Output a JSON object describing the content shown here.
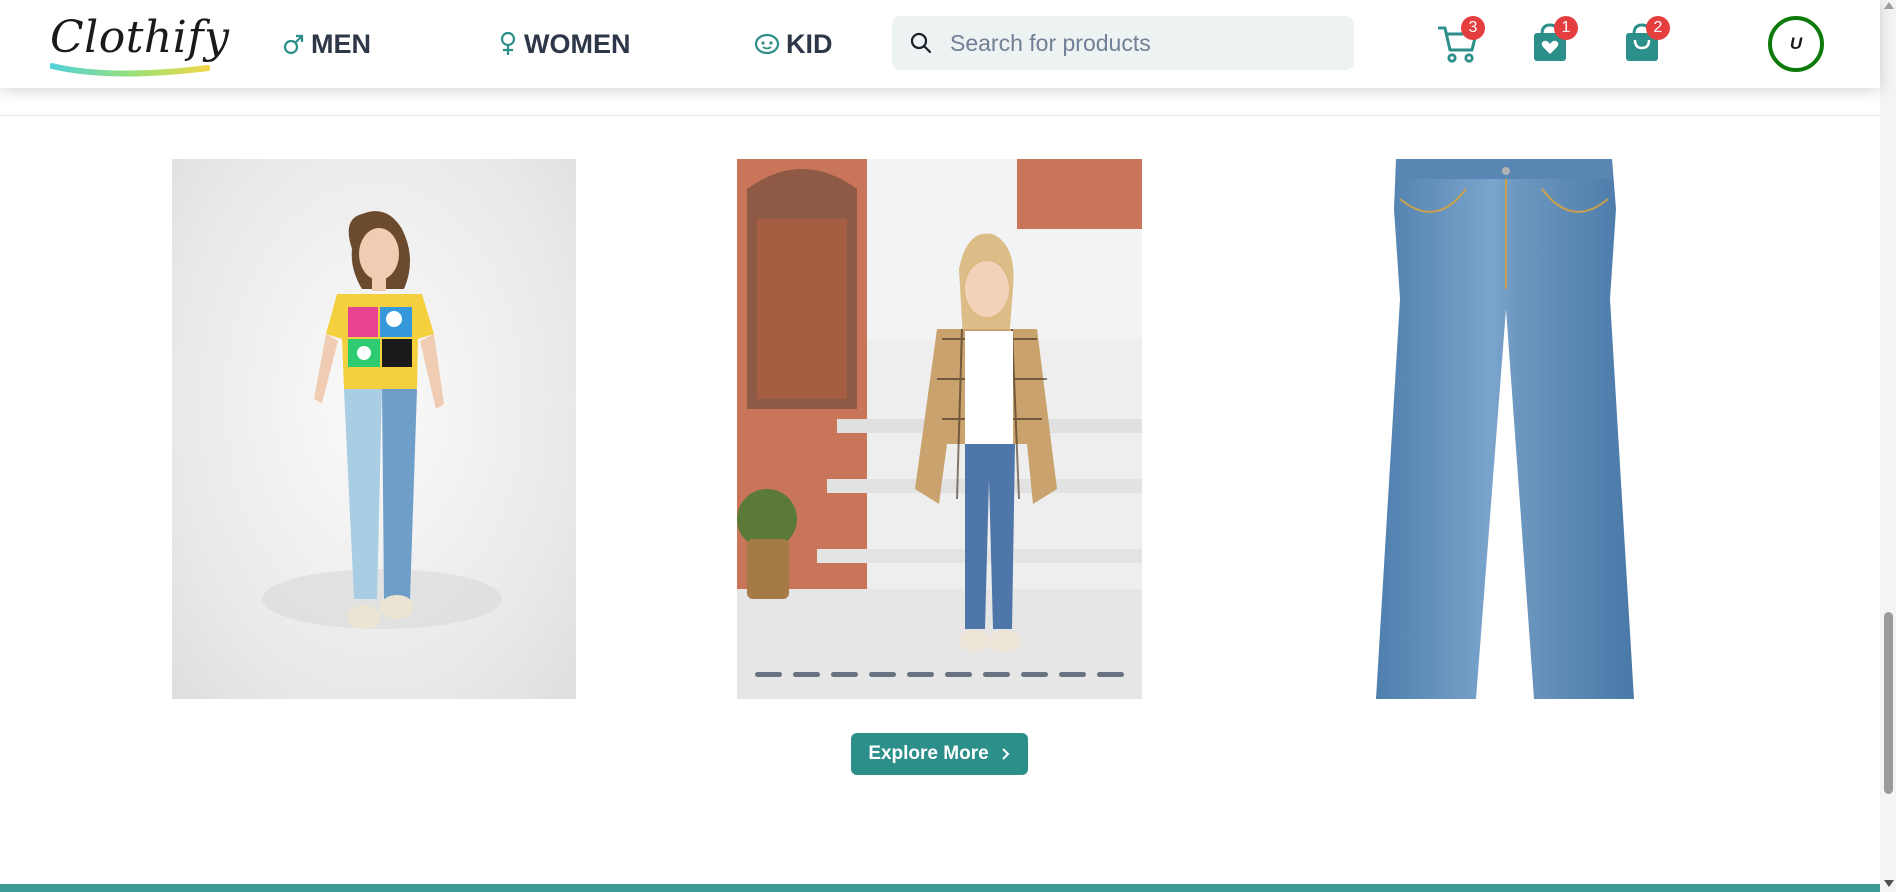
{
  "brand": {
    "name": "Clothify"
  },
  "nav": [
    {
      "label": "MEN",
      "icon": "male-icon"
    },
    {
      "label": "WOMEN",
      "icon": "female-icon"
    },
    {
      "label": "KID",
      "icon": "kid-face-icon"
    }
  ],
  "search": {
    "placeholder": "Search for products",
    "value": ""
  },
  "actions": {
    "cart_count": "3",
    "wishlist_count": "1",
    "orders_count": "2"
  },
  "user": {
    "initial": "U"
  },
  "products": [
    {
      "name": "girl-printed-tee-two-tone-jeans-image"
    },
    {
      "name": "girl-plaid-shirt-skinny-jeans-image",
      "carousel_slides": 10
    },
    {
      "name": "flared-jeans-image"
    }
  ],
  "explore": {
    "label": "Explore More"
  },
  "colors": {
    "accent": "#2d8f8a",
    "badge": "#e53e3e",
    "avatar_ring": "#0b7a0b",
    "search_bg": "#edf2f2"
  }
}
